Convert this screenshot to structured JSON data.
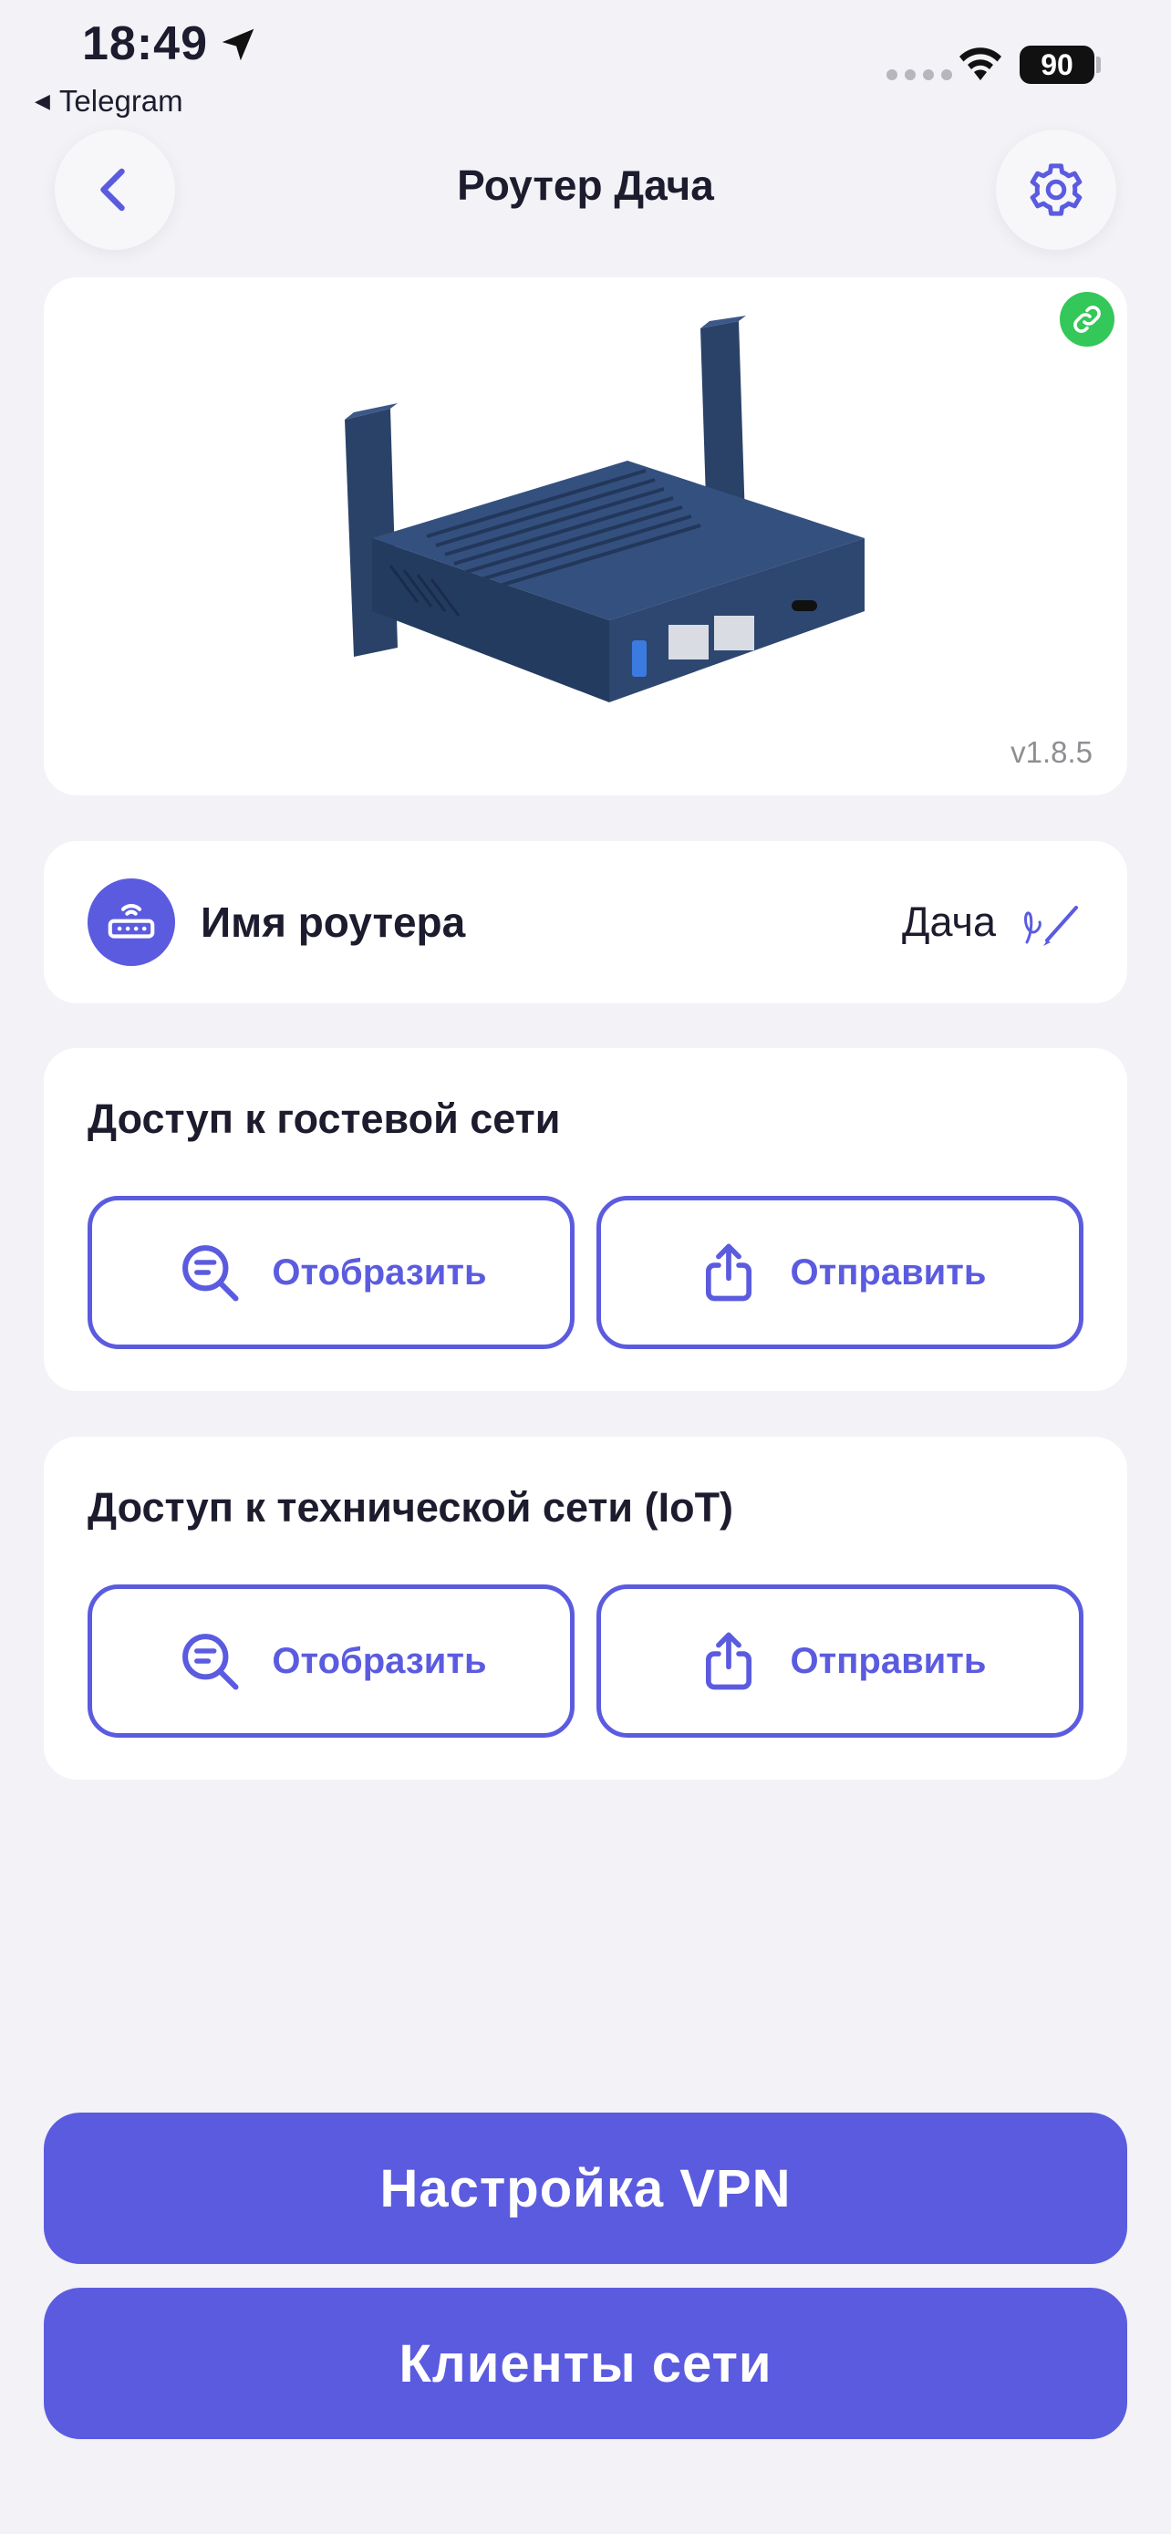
{
  "status_bar": {
    "time": "18:49",
    "back_app": "Telegram",
    "battery": "90",
    "icons": [
      "location-arrow-icon",
      "signal-icon",
      "wifi-icon",
      "battery-icon"
    ]
  },
  "header": {
    "title": "Роутер Дача",
    "back_icon": "chevron-left-icon",
    "settings_icon": "gear-icon"
  },
  "device": {
    "version": "v1.8.5",
    "link_icon": "link-icon",
    "image_icon": "router-image"
  },
  "router_name": {
    "label": "Имя роутера",
    "value": "Дача",
    "icon": "router-icon",
    "edit_icon": "pen-icon"
  },
  "guest_access": {
    "title": "Доступ к гостевой сети",
    "show_label": "Отобразить",
    "send_label": "Отправить"
  },
  "iot_access": {
    "title": "Доступ к технической сети (IoT)",
    "show_label": "Отобразить",
    "send_label": "Отправить"
  },
  "actions": {
    "vpn_label": "Настройка VPN",
    "clients_label": "Клиенты сети"
  },
  "colors": {
    "accent": "#5b5be0",
    "background": "#f2f2f7",
    "link_badge": "#34c759",
    "router_body": "#2d4770"
  }
}
